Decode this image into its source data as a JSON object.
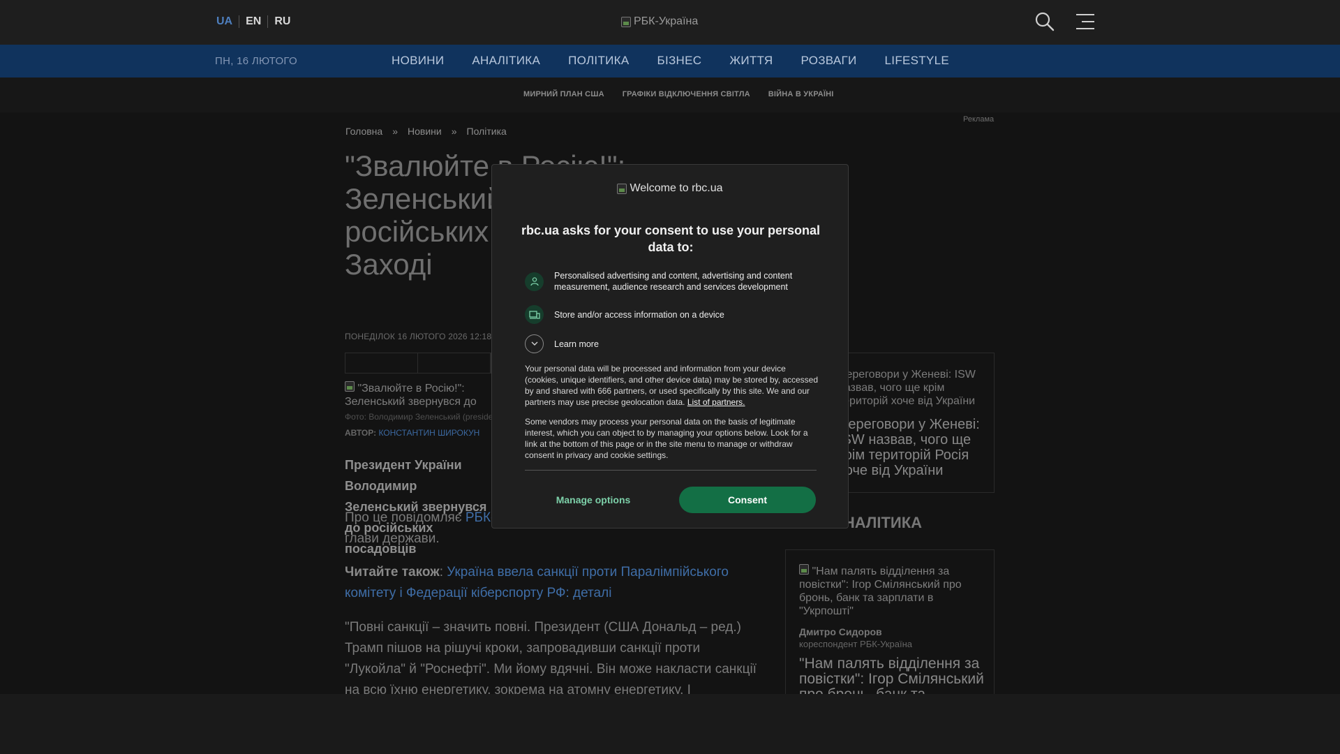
{
  "header": {
    "languages": [
      "UA",
      "EN",
      "RU"
    ],
    "logo_alt": "РБК-Україна"
  },
  "nav": {
    "date": "ПН, 16 ЛЮТОГО",
    "items": [
      "НОВИНИ",
      "АНАЛІТИКА",
      "ПОЛІТИКА",
      "БІЗНЕС",
      "ЖИТТЯ",
      "РОЗВАГИ",
      "LIFESTYLE"
    ]
  },
  "subnav": {
    "items": [
      "МИРНИЙ ПЛАН США",
      "ГРАФІКИ ВІДКЛЮЧЕННЯ СВІТЛА",
      "ВІЙНА В УКРАЇНІ"
    ]
  },
  "ad_label": "Реклама",
  "breadcrumb": [
    "Головна",
    "»",
    "Новини",
    "»",
    "Політика"
  ],
  "article": {
    "headline": "\"Звалюйте в Росію!\": Зеленський звернувся до російських посадовців на Заході",
    "date": "ПОНЕДІЛОК 16 ЛЮТОГО 2026 12:18",
    "photo_alt": "\"Звалюйте в Росію!\": Зеленський звернувся до російських посадовців на Заході",
    "photo_caption": "Фото: Володимир Зеленський (president.gov.ua)",
    "author_label": "АВТОР:",
    "author_name": "КОНСТАНТИН ШИРОКУН",
    "lead": "Президент України Володимир Зеленський звернувся до російських посадовців",
    "para1_start": "Про це повідомляє ",
    "para1_link": "РБК-Україна",
    "para1_end": " з посиланням на звернення глави держави.",
    "read_also_label": "Читайте також",
    "read_also_link": "Україна ввела санкції проти Паралімпійського комітету і Федерації кіберспорту РФ: деталі",
    "quote": "\"Повні санкції – значить повні. Президент (США Дональд – ред.) Трамп пішов на рішучі кроки, запровадивши санкції проти \"Лукойла\" й \"Роснефті\". Ми йому вдячні. Він може накласти санкції на всю їхню енергетику, зокрема на атомну енергетику. І"
  },
  "sidebar": {
    "card1_alt": "Переговори у Женеві: ISW назвав, чого ще крім територій хоче від України",
    "card1_title": "Переговори у Женеві: ISW назвав, чого ще крім територій Росія хоче від України",
    "section_title": "АНАЛІТИКА",
    "card2_alt": "\"Нам палять відділення за повістки\": Ігор Смілянський про бронь, банк та зарплати в \"Укрпошті\"",
    "card2_author": "Дмитро Сидоров",
    "card2_role": "кореспондент РБК-Україна",
    "card2_title": "\"Нам палять відділення за повістки\": Ігор Смілянський про бронь, банк та зарплати"
  },
  "consent": {
    "logo_alt": "Welcome to rbc.ua",
    "title": "rbc.ua asks for your consent to use your personal data to:",
    "purposes": [
      {
        "icon": "person-icon",
        "text": "Personalised advertising and content, advertising and content measurement, audience research and services development"
      },
      {
        "icon": "devices-icon",
        "text": "Store and/or access information on a device"
      }
    ],
    "learn_more": "Learn more",
    "para1": "Your personal data will be processed and information from your device (cookies, unique identifiers, and other device data) may be stored by, accessed by and shared with 666 partners, or used specifically by this site. We and our partners may use precise geolocation data. ",
    "partners_link": "List of partners.",
    "para2": "Some vendors may process your personal data on the basis of legitimate interest, which you can object to by managing your options below. Look for a link at the bottom of this page or in the site menu to manage or withdraw consent in privacy and cookie settings.",
    "manage_label": "Manage options",
    "consent_label": "Consent"
  },
  "colors": {
    "nav_bg": "#10335d",
    "consent_button": "#136f45",
    "manage_text": "#7dd0a9",
    "link": "#3f6ea8"
  }
}
